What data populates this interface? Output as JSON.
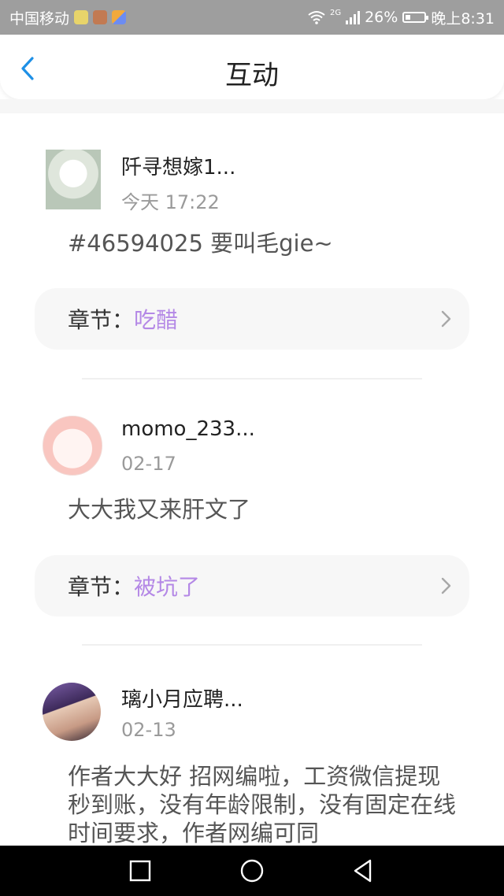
{
  "status_bar": {
    "carrier": "中国移动",
    "network": "2G",
    "battery": "26%",
    "battery_level": 0.26,
    "time": "晚上8:31"
  },
  "header": {
    "title": "互动",
    "back_icon": "chevron-left-icon"
  },
  "comments": [
    {
      "user": "阡寻想嫁1...",
      "time": "今天 17:22",
      "text": "#46594025 要叫毛gie~",
      "chapter_label": "章节：",
      "chapter_value": "吃醋"
    },
    {
      "user": "momo_233...",
      "time": "02-17",
      "text": "大大我又来肝文了",
      "chapter_label": "章节：",
      "chapter_value": "被坑了"
    },
    {
      "user": "璃小月应聘...",
      "time": "02-13",
      "text": "作者大大好 招网编啦，工资微信提现秒到账，没有年龄限制，没有固定在线时间要求，作者网编可同"
    }
  ],
  "colors": {
    "accent_blue": "#1e90e6",
    "chapter_purple": "#b488e6",
    "status_bar": "#9e9e9e"
  }
}
